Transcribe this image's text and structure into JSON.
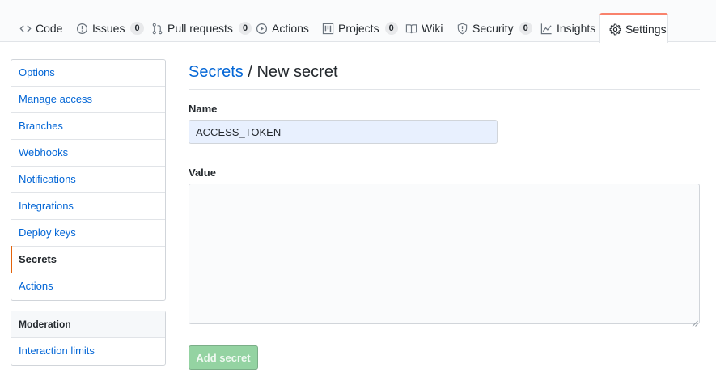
{
  "repo_nav": {
    "tabs": [
      {
        "label": "Code",
        "icon": "code-icon"
      },
      {
        "label": "Issues",
        "icon": "issue-icon",
        "count": "0"
      },
      {
        "label": "Pull requests",
        "icon": "pull-request-icon",
        "count": "0"
      },
      {
        "label": "Actions",
        "icon": "play-icon"
      },
      {
        "label": "Projects",
        "icon": "project-icon",
        "count": "0"
      },
      {
        "label": "Wiki",
        "icon": "book-icon"
      },
      {
        "label": "Security",
        "icon": "shield-icon",
        "count": "0"
      },
      {
        "label": "Insights",
        "icon": "graph-icon"
      },
      {
        "label": "Settings",
        "icon": "gear-icon",
        "selected": true
      }
    ],
    "selected_tab_accent": "#f9826c"
  },
  "sidebar": {
    "items": [
      {
        "label": "Options"
      },
      {
        "label": "Manage access"
      },
      {
        "label": "Branches"
      },
      {
        "label": "Webhooks"
      },
      {
        "label": "Notifications"
      },
      {
        "label": "Integrations"
      },
      {
        "label": "Deploy keys"
      },
      {
        "label": "Secrets",
        "active": true
      },
      {
        "label": "Actions"
      }
    ],
    "moderation": {
      "header": "Moderation",
      "items": [
        {
          "label": "Interaction limits"
        }
      ]
    }
  },
  "main": {
    "breadcrumb_link": "Secrets",
    "breadcrumb_sep": " / ",
    "title": "New secret",
    "name_label": "Name",
    "name_value": "ACCESS_TOKEN",
    "value_label": "Value",
    "value_value": "",
    "submit_label": "Add secret",
    "submit_color": "#94d3a2"
  }
}
